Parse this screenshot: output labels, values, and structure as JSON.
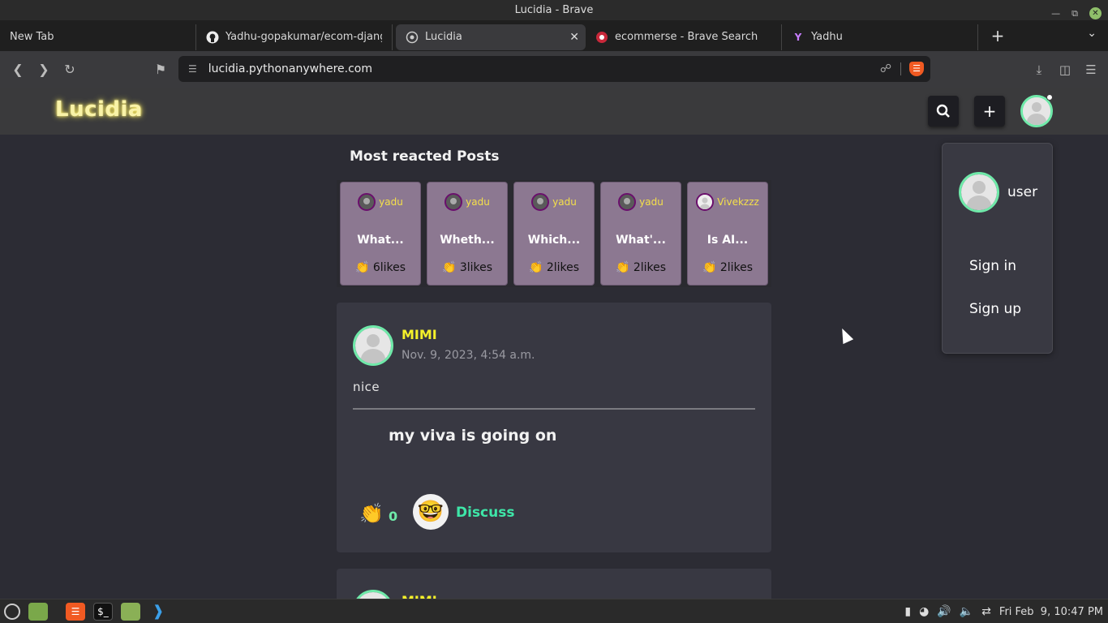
{
  "window": {
    "title": "Lucidia - Brave"
  },
  "tabs": [
    {
      "label": "New Tab",
      "icon": "none"
    },
    {
      "label": "Yadhu-gopakumar/ecom-django",
      "icon": "github-icon"
    },
    {
      "label": "Lucidia",
      "icon": "globe-icon",
      "active": true
    },
    {
      "label": "ecommerse - Brave Search",
      "icon": "brave-search-icon"
    },
    {
      "label": "Yadhu",
      "icon": "y-icon"
    }
  ],
  "toolbar": {
    "url": "lucidia.pythonanywhere.com"
  },
  "site": {
    "logo": "Lucidia",
    "search_glyph": "🔍",
    "add_glyph": "+"
  },
  "most_reacted": {
    "title": "Most reacted Posts",
    "posts": [
      {
        "author": "yadu",
        "title": "What...",
        "likes": "👏 6likes"
      },
      {
        "author": "yadu",
        "title": "Wheth...",
        "likes": "👏 3likes"
      },
      {
        "author": "yadu",
        "title": "Which...",
        "likes": "👏 2likes"
      },
      {
        "author": "yadu",
        "title": "What'...",
        "likes": "👏 2likes"
      },
      {
        "author": "Vivekzzz",
        "title": "Is AI...",
        "likes": "👏 2likes"
      }
    ]
  },
  "feed": [
    {
      "user": "MIMI",
      "date": "Nov. 9, 2023, 4:54 a.m.",
      "body": "nice",
      "title": "my viva is going on",
      "claps": "0",
      "discuss_label": "Discuss"
    },
    {
      "user": "MIMI"
    }
  ],
  "dropdown": {
    "username": "user",
    "sign_in": "Sign in",
    "sign_up": "Sign up"
  },
  "taskbar": {
    "clock": "Fri Feb  9, 10:47 PM"
  },
  "colors": {
    "accent_green": "#6fe9a9",
    "username_yellow": "#f4f02a",
    "logo_glow": "#ffef5a"
  }
}
